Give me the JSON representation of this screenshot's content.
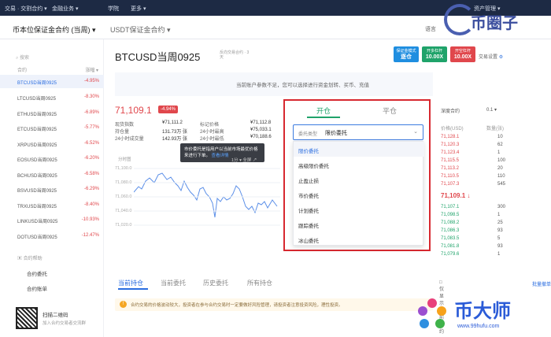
{
  "topbar": {
    "nav": [
      "交易 · 交割合约 ▾",
      "金融业务 ▾",
      "学院",
      "更多 ▾"
    ],
    "right": "资产管理 ▾"
  },
  "subbar": {
    "tab_coin": "币本位保证金合约 (当周) ▾",
    "tab_usdt": "USDT保证金合约 ▾",
    "right_label": "语言"
  },
  "sidebar": {
    "search_placeholder": "搜索",
    "col_change": "涨幅 ▾",
    "items": [
      {
        "name": "BTCUSD当周0925",
        "change": "-4.95%"
      },
      {
        "name": "LTCUSD当周0925",
        "change": "-8.30%"
      },
      {
        "name": "ETHUSD当周0925",
        "change": "-6.89%"
      },
      {
        "name": "ETCUSD当周0925",
        "change": "-5.77%"
      },
      {
        "name": "XRPUSD当周0925",
        "change": "-6.52%"
      },
      {
        "name": "EOSUSD当周0925",
        "change": "-6.20%"
      },
      {
        "name": "BCHUSD当周0925",
        "change": "-6.58%"
      },
      {
        "name": "BSVUSD当周0925",
        "change": "-6.29%"
      },
      {
        "name": "TRXUSD当周0925",
        "change": "-8.40%"
      },
      {
        "name": "LINKUSD当周0925",
        "change": "-10.93%"
      },
      {
        "name": "DOTUSD当周0925",
        "change": "-12.47%"
      }
    ],
    "help_title": "合约帮助",
    "help_links": [
      "合约委托",
      "合约账单"
    ],
    "qr_text": "扫描二维码",
    "qr_sub": "加入合约交易者交流群"
  },
  "main": {
    "contract_title": "BTCUSD当周0925",
    "contract_sub": "反向交易合约 · 3天",
    "mode_buttons": [
      {
        "top": "保证金模式",
        "label": "逐仓",
        "color": "#1f8ee0"
      },
      {
        "top": "开多杠杆",
        "label": "10.00X",
        "color": "#1fa36a"
      },
      {
        "top": "开空杠杆",
        "label": "10.00X",
        "color": "#e0474c"
      }
    ],
    "trade_settings": "交易设置",
    "notice": "当前账户参数不足，您可以选择进行资金划转、买币、充值",
    "price": "71,109.1",
    "price_change": "-4.94%",
    "stats": [
      {
        "label": "现货指数",
        "value": "¥71,111.2",
        "label2": "标记价格",
        "value2": "¥71,112.8"
      },
      {
        "label": "持仓量",
        "value": "131.73万 张",
        "label2": "24小时最高",
        "value2": "¥75,033.1"
      },
      {
        "label": "24小时成交量",
        "value": "142.93万 张",
        "label2": "24小时最低",
        "value2": "¥70,188.6"
      }
    ],
    "chart_label": "分时图",
    "y_ticks": [
      "71,100.0",
      "71,080.0",
      "71,060.0",
      "71,040.0",
      "71,020.0"
    ],
    "tooltip_text": "市价委托是指用户以当前市场最优价格来进行下单。",
    "tooltip_link": "查看详情",
    "chart_toolbar": "1分 ▾  全屏 ↗"
  },
  "order_panel": {
    "tab_open": "开仓",
    "tab_close": "平仓",
    "type_label": "委托类型",
    "type_value": "限价委托",
    "options": [
      "限价委托",
      "高级限价委托",
      "止盈止损",
      "市价委托",
      "计划委托",
      "跟踪委托",
      "冰山委托"
    ]
  },
  "order_book": {
    "title": "深度合约",
    "precision": "0.1 ▾",
    "col_price": "价格(USD)",
    "col_qty": "数量(张)",
    "asks": [
      {
        "p": "71,128.1",
        "q": "10"
      },
      {
        "p": "71,120.3",
        "q": "62"
      },
      {
        "p": "71,123.4",
        "q": "1"
      },
      {
        "p": "71,115.5",
        "q": "100"
      },
      {
        "p": "71,113.2",
        "q": "20"
      },
      {
        "p": "71,110.5",
        "q": "110"
      },
      {
        "p": "71,107.3",
        "q": "545"
      }
    ],
    "last": "71,109.1 ↓",
    "bids": [
      {
        "p": "71,107.1",
        "q": "300"
      },
      {
        "p": "71,098.5",
        "q": "1"
      },
      {
        "p": "71,088.2",
        "q": "25"
      },
      {
        "p": "71,086.3",
        "q": "93"
      },
      {
        "p": "71,083.5",
        "q": "5"
      },
      {
        "p": "71,081.8",
        "q": "93"
      },
      {
        "p": "71,079.6",
        "q": "1"
      }
    ]
  },
  "bottom": {
    "tabs": [
      "当前持仓",
      "当前委托",
      "历史委托",
      "所有持仓"
    ],
    "right_check": "□ 仅显示当前合约",
    "right_link": "批量撤单",
    "banner": "合约交易的价格波动较大，投资者在参与合约交易时一定要做好风险管理，请投资者注意投资风险，理性投资。"
  },
  "watermark": {
    "text": "币圈子"
  },
  "logo2": {
    "text": "币大师",
    "url": "www.99hufu.com"
  }
}
